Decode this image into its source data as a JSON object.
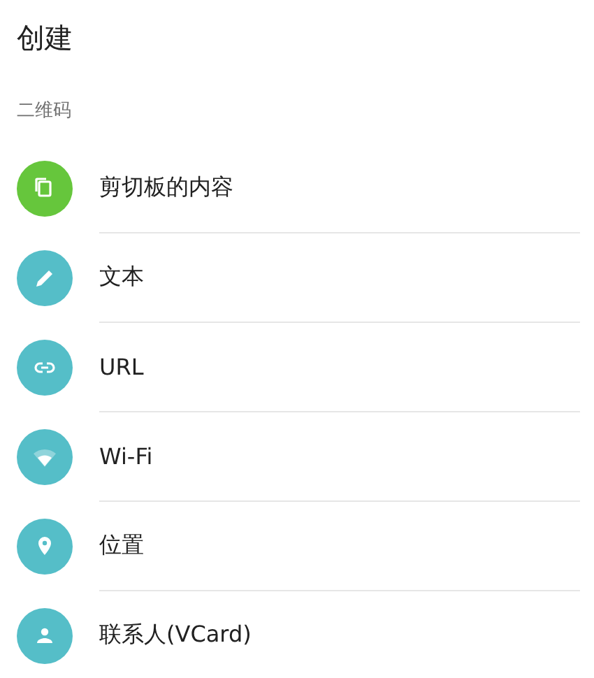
{
  "title": "创建",
  "section": {
    "label": "二维码"
  },
  "items": [
    {
      "label": "剪切板的内容",
      "kind": "clipboard",
      "color": "#66c63c"
    },
    {
      "label": "文本",
      "kind": "pencil",
      "color": "#55bec8"
    },
    {
      "label": "URL",
      "kind": "link",
      "color": "#55bec8"
    },
    {
      "label": "Wi-Fi",
      "kind": "wifi",
      "color": "#55bec8"
    },
    {
      "label": "位置",
      "kind": "pin",
      "color": "#55bec8"
    },
    {
      "label": "联系人(VCard)",
      "kind": "person",
      "color": "#55bec8"
    }
  ]
}
